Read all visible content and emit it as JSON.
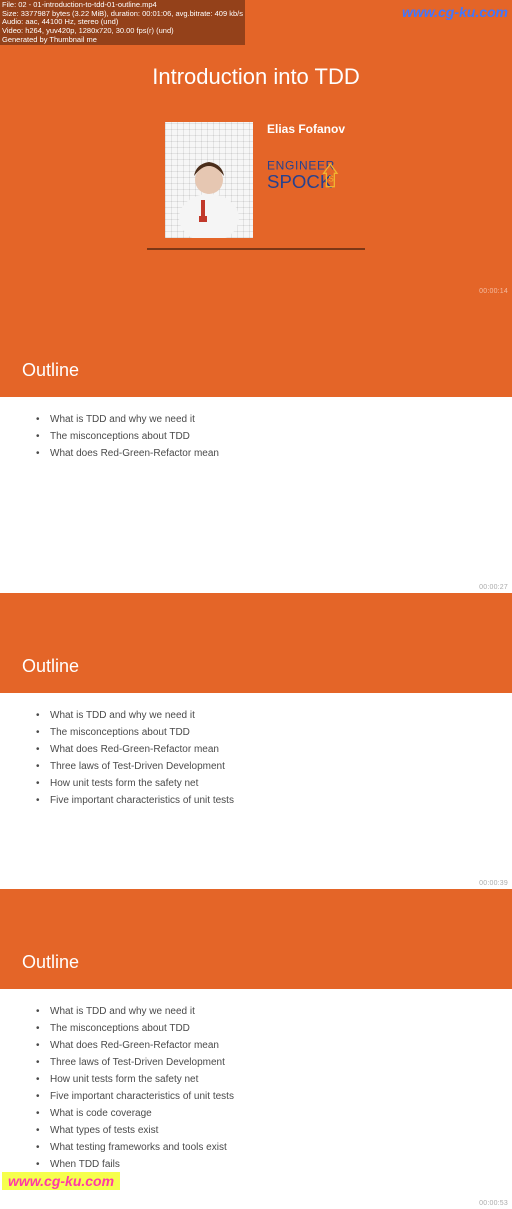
{
  "watermark_top": "www.cg-ku.com",
  "watermark_bottom": "www.cg-ku.com",
  "meta": {
    "file": "File: 02 - 01-introduction-to-tdd-01-outline.mp4",
    "size": "Size: 3377987 bytes (3.22 MiB), duration: 00:01:06, avg.bitrate: 409 kb/s",
    "audio": "Audio: aac, 44100 Hz, stereo (und)",
    "video": "Video: h264, yuv420p, 1280x720, 30.00 fps(r) (und)",
    "gen": "Generated by Thumbnail me"
  },
  "slide1": {
    "title": "Introduction into TDD",
    "author": "Elias Fofanov",
    "logo_text_top": "ENGINEER",
    "logo_text_bottom": "SPOCK",
    "timestamp": "00:00:14"
  },
  "slide2": {
    "heading": "Outline",
    "items": [
      "What is TDD and why we need it",
      "The misconceptions about TDD",
      "What does Red-Green-Refactor mean"
    ],
    "timestamp": "00:00:27"
  },
  "slide3": {
    "heading": "Outline",
    "items": [
      "What is TDD and why we need it",
      "The misconceptions about TDD",
      "What does Red-Green-Refactor mean",
      "Three laws of Test-Driven Development",
      "How unit tests form the safety net",
      "Five important characteristics of unit tests"
    ],
    "timestamp": "00:00:39"
  },
  "slide4": {
    "heading": "Outline",
    "items": [
      "What is TDD and why we need it",
      "The misconceptions about TDD",
      "What does Red-Green-Refactor mean",
      "Three laws of Test-Driven Development",
      "How unit tests form the safety net",
      "Five important characteristics of unit tests",
      "What is code coverage",
      "What types of tests exist",
      "What testing frameworks and tools exist",
      "When TDD fails"
    ],
    "timestamp": "00:00:53"
  }
}
